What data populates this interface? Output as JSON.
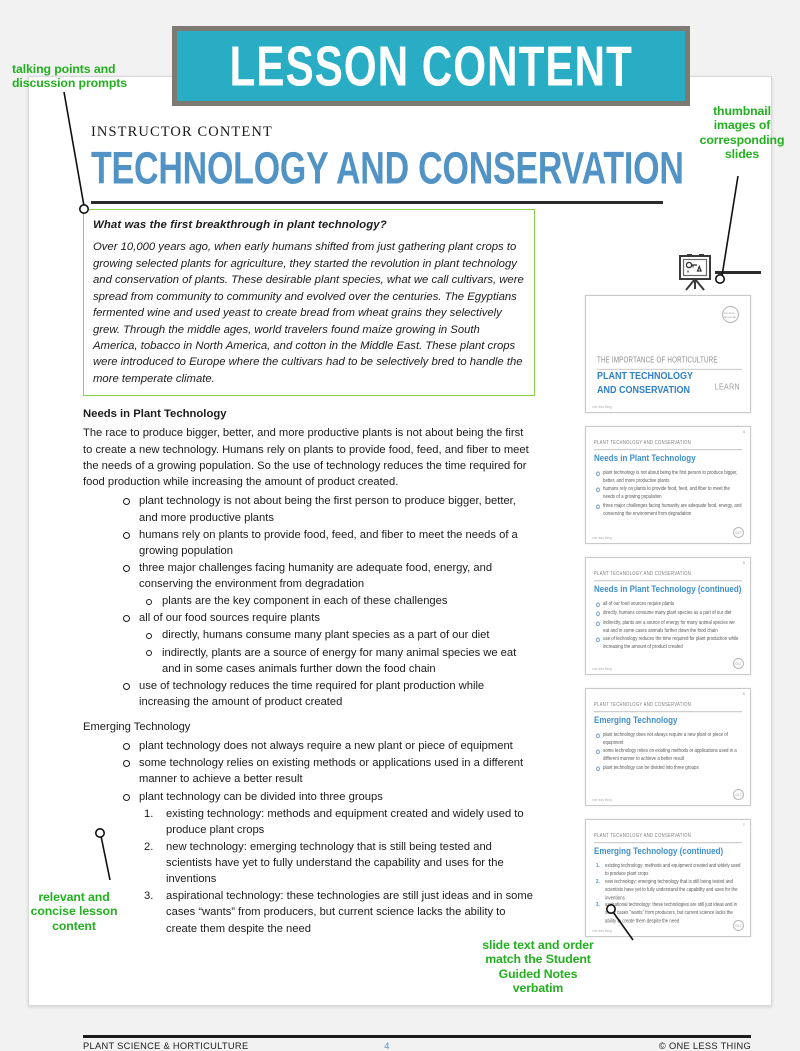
{
  "banner": {
    "label": "LESSON CONTENT"
  },
  "title": {
    "eyebrow": "INSTRUCTOR CONTENT",
    "main": "TECHNOLOGY AND CONSERVATION",
    "icon": "easel-presentation-icon"
  },
  "callout": {
    "question": "What was the first breakthrough in plant technology?",
    "answer": "Over 10,000 years ago, when early humans shifted from just gathering plant crops to growing selected plants for agriculture, they started the revolution in plant technology and conservation of plants. These desirable plant species, what we call cultivars, were spread from community to community and evolved over the centuries. The Egyptians fermented wine and used yeast to create bread from wheat grains they selectively grew. Through the middle ages, world travelers found maize growing in South America, tobacco in North America, and cotton in the Middle East. These plant crops were introduced to Europe where the cultivars had to be selectively bred to handle the more temperate climate.",
    "border_color": "#8cd04f"
  },
  "sections": {
    "needs_heading": "Needs in Plant Technology",
    "needs_paragraph": "The race to produce bigger, better, and more productive plants is not about being the first to create a new technology. Humans rely on plants to provide food, feed, and fiber to meet the needs of a growing population. So the use of technology reduces the time required for food production while increasing the amount of product created.",
    "needs_bullets": [
      "plant technology is not about being the first person to produce bigger, better, and more productive plants",
      "humans rely on plants to provide food, feed, and fiber to meet the needs of a growing population",
      "three major challenges facing humanity are adequate food, energy, and conserving the environment from degradation",
      "plants are the key component in each of these challenges",
      "all of our food sources require plants",
      "directly, humans consume many plant species as a part of our diet",
      "indirectly, plants are a source of energy for many animal species we eat and in some cases animals further down the food chain",
      "use of technology reduces the time required for plant production while increasing the amount of product created"
    ],
    "emerging_heading": "Emerging Technology",
    "emerging_bullets": [
      "plant technology does not always require a new plant or piece of equipment",
      "some technology relies on existing methods or applications used in a different manner to achieve a better result",
      "plant technology can be divided into three groups"
    ],
    "emerging_numbered": [
      "existing technology: methods and equipment created and widely used to produce plant crops",
      "new technology: emerging technology that is still being tested and scientists have yet to fully understand the capability and uses for the inventions",
      "aspirational technology: these technologies are still just ideas and in some cases “wants” from producers, but current science lacks the ability to create them despite the need"
    ]
  },
  "thumbnails": [
    {
      "type": "title",
      "eyebrow": "THE IMPORTANCE OF HORTICULTURE",
      "title": "PLANT TECHNOLOGY AND CONSERVATION",
      "learn": "LEARN",
      "logo": "one-less-thing-logo",
      "footer": "one less thing"
    },
    {
      "type": "bullets",
      "eyebrow": "PLANT TECHNOLOGY AND CONSERVATION",
      "title": "Needs in Plant Technology",
      "bullets": [
        "plant technology is not about being the first person to produce bigger, better, and more productive plants",
        "humans rely on plants to provide food, feed, and fiber to meet the needs of a growing population",
        "three major challenges facing humanity are adequate food, energy, and conserving the environment from degradation"
      ],
      "footer": "one less thing",
      "badge": "OLT",
      "pagenum": "4"
    },
    {
      "type": "bullets",
      "eyebrow": "PLANT TECHNOLOGY AND CONSERVATION",
      "title": "Needs in Plant Technology (continued)",
      "bullets": [
        "all of our food sources require plants",
        "directly, humans consume many plant species as a part of our diet",
        "indirectly, plants are a source of energy for many animal species we eat and in some cases animals further down the food chain",
        "use of technology reduces the time required for plant production while increasing the amount of product created"
      ],
      "footer": "one less thing",
      "badge": "OLT",
      "pagenum": "5"
    },
    {
      "type": "bullets",
      "eyebrow": "PLANT TECHNOLOGY AND CONSERVATION",
      "title": "Emerging Technology",
      "bullets": [
        "plant technology does not always require a new plant or piece of equipment",
        "some technology relies on existing methods or applications used in a different manner to achieve a better result",
        "plant technology can be divided into three groups"
      ],
      "footer": "one less thing",
      "badge": "OLT",
      "pagenum": "6"
    },
    {
      "type": "numbered",
      "eyebrow": "PLANT TECHNOLOGY AND CONSERVATION",
      "title": "Emerging Technology (continued)",
      "items": [
        "existing technology: methods and equipment created and widely used to produce plant crops",
        "new technology: emerging technology that is still being tested and scientists have yet to fully understand the capability and uses for the inventions",
        "aspirational technology: these technologies are still just ideas and in some cases “wants” from producers, but current science lacks the ability to create them despite the need"
      ],
      "footer": "one less thing",
      "badge": "OLT",
      "pagenum": "7"
    }
  ],
  "footer": {
    "left": "PLANT SCIENCE & HORTICULTURE",
    "page": "4",
    "right": "© ONE LESS THING"
  },
  "annotations": [
    {
      "id": "talking-points",
      "text": "talking points and\ndiscussion prompts"
    },
    {
      "id": "thumbnail-images",
      "text": "thumbnail\nimages of\ncorresponding\nslides"
    },
    {
      "id": "relevant-content",
      "text": "relevant and\nconcise lesson\ncontent"
    },
    {
      "id": "slide-text-order",
      "text": "slide text and order\nmatch the Student\nGuided Notes\nverbatim"
    }
  ],
  "colors": {
    "banner_teal": "#29ADC4",
    "title_blue": "#5193c4",
    "annotation_green": "#22b01e",
    "callout_green": "#8cd04f"
  }
}
